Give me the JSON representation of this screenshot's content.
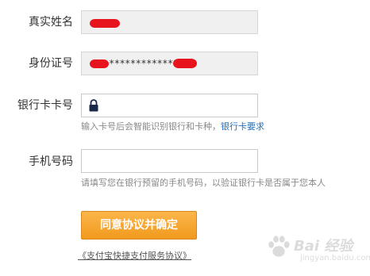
{
  "form": {
    "name": {
      "label": "真实姓名",
      "value": ""
    },
    "id_number": {
      "label": "身份证号",
      "value": "*************"
    },
    "bank_card": {
      "label": "银行卡卡号",
      "value": "",
      "hint_text": "输入卡号后会智能识别银行和卡种，",
      "hint_link": "银行卡要求"
    },
    "phone": {
      "label": "手机号码",
      "value": "",
      "hint_text": "请填写您在银行预留的手机号码，以验证银行卡是否属于您本人"
    },
    "submit_label": "同意协议并确定",
    "agreement_link": "《支付宝快捷支付服务协议》"
  },
  "watermark": {
    "logo_text": "Bai 经验",
    "url_text": "jingyan.baidu.com"
  },
  "colors": {
    "button": "#f5a623",
    "link": "#1f6fbf",
    "redaction": "#e8141d"
  }
}
